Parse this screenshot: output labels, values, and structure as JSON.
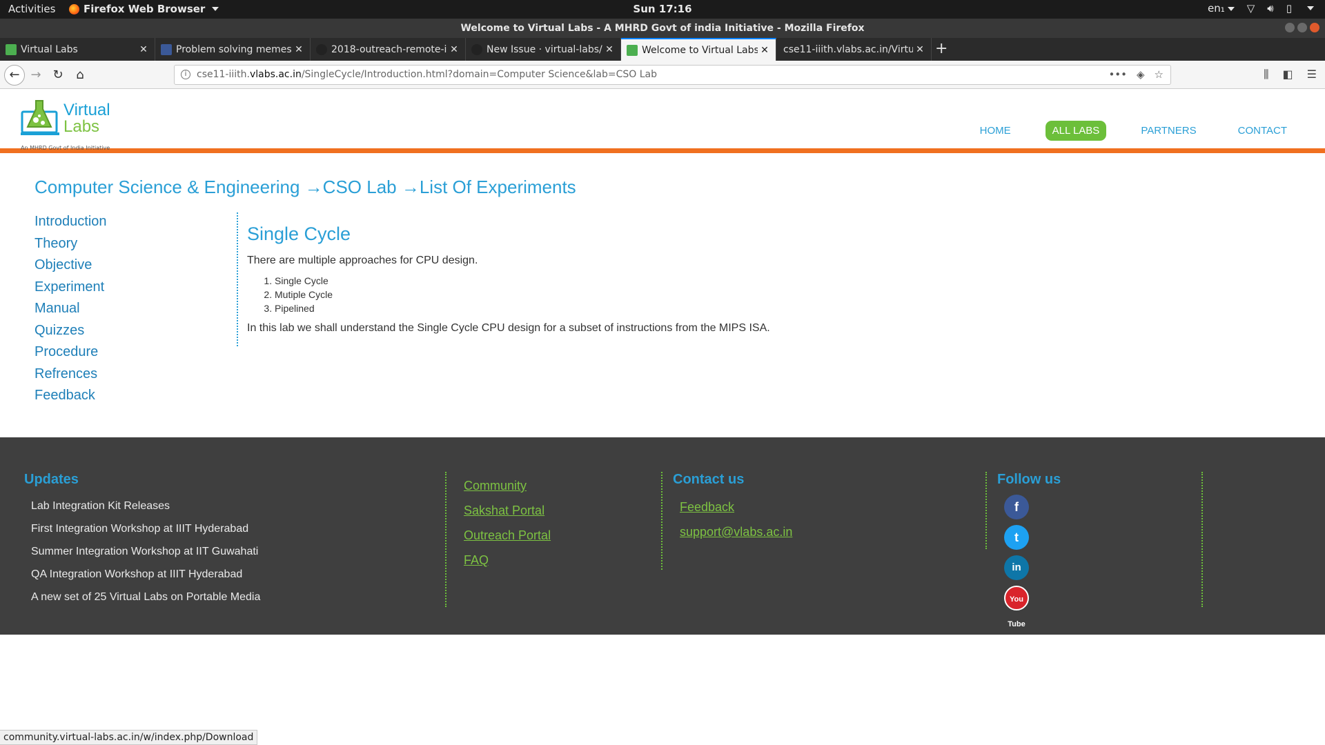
{
  "system": {
    "activities": "Activities",
    "app_name": "Firefox Web Browser",
    "clock": "Sun 17:16",
    "lang": "en₁"
  },
  "window": {
    "title": "Welcome to Virtual Labs - A MHRD Govt of india Initiative - Mozilla Firefox"
  },
  "tabs": [
    {
      "label": "Virtual Labs",
      "favicon": "#4caf50"
    },
    {
      "label": "Problem solving memes",
      "favicon": "#3b5998"
    },
    {
      "label": "2018-outreach-remote-i",
      "favicon": "#222222"
    },
    {
      "label": "New Issue · virtual-labs/c",
      "favicon": "#222222"
    },
    {
      "label": "Welcome to Virtual Labs",
      "favicon": "#4caf50"
    },
    {
      "label": "cse11-iiith.vlabs.ac.in/Virtu",
      "favicon": ""
    }
  ],
  "url": {
    "prefix": "cse11-iiith.",
    "domain": "vlabs.ac.in",
    "path": "/SingleCycle/Introduction.html?domain=Computer Science&lab=CSO Lab"
  },
  "site": {
    "logo_top": "Virtual",
    "logo_bottom": "Labs",
    "logo_tagline": "An MHRD Govt of India Initiative",
    "nav": [
      "HOME",
      "ALL LABS",
      "PARTNERS",
      "CONTACT"
    ],
    "nav_active": "ALL LABS"
  },
  "breadcrumb": "Computer Science & Engineering →CSO Lab →List Of Experiments",
  "sidemenu": [
    "Introduction",
    "Theory",
    "Objective",
    "Experiment",
    "Manual",
    "Quizzes",
    "Procedure",
    "Refrences",
    "Feedback"
  ],
  "content": {
    "title": "Single Cycle",
    "intro": "There are multiple approaches for CPU design.",
    "list": [
      "Single Cycle",
      "Mutiple Cycle",
      "Pipelined"
    ],
    "summary": "In this lab we shall understand the Single Cycle CPU design for a subset of instructions from the MIPS ISA."
  },
  "footer": {
    "updates_title": "Updates",
    "updates": [
      "Lab Integration Kit Releases",
      "First Integration Workshop at IIIT Hyderabad",
      "Summer Integration Workshop at IIT Guwahati",
      "QA Integration Workshop at IIIT Hyderabad",
      "A new set of 25 Virtual Labs on Portable Media"
    ],
    "links": [
      "Community",
      "Sakshat Portal",
      "Outreach Portal",
      "FAQ"
    ],
    "contact_title": "Contact us",
    "contact": [
      "Feedback",
      "support@vlabs.ac.in"
    ],
    "follow_title": "Follow us",
    "social": [
      "facebook-icon",
      "twitter-icon",
      "linkedin-icon",
      "youtube-icon"
    ],
    "social_glyphs": [
      "f",
      "t",
      "in",
      "You Tube"
    ]
  },
  "status_text": "community.virtual-labs.ac.in/w/index.php/Download",
  "colors": {
    "accent_blue": "#2a9fd6",
    "accent_green": "#6cbf3a",
    "header_orange": "#f07020",
    "footer_bg": "#3f3f3f"
  }
}
